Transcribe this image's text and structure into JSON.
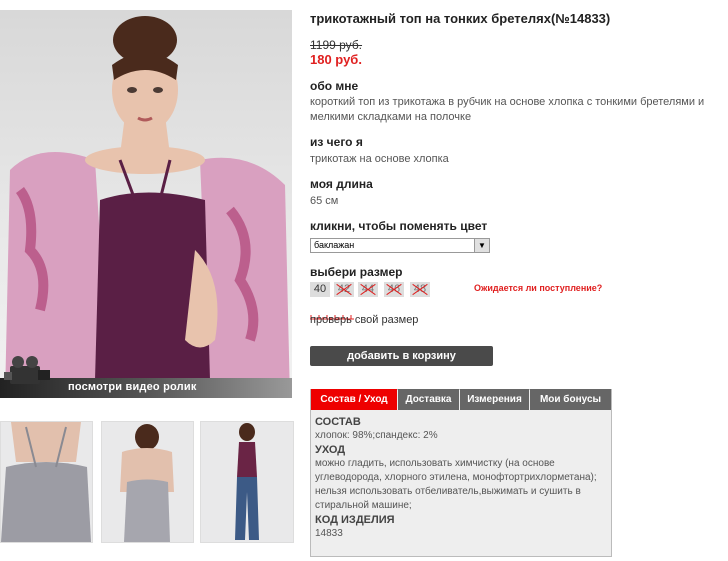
{
  "product": {
    "title": "трикотажный топ на тонких бретелях(№14833)",
    "old_price": "1199 руб.",
    "new_price": "180 руб."
  },
  "sections": {
    "about_heading": "обо мне",
    "about_text": "короткий топ из трикотажа в рубчик на основе хлопка с тонкими бретелями и мелкими складками на полочке",
    "material_heading": "из чего я",
    "material_text": "трикотаж на основе хлопка",
    "length_heading": "моя длина",
    "length_text": "65 см",
    "color_heading": "кликни, чтобы поменять цвет",
    "color_value": "баклажан",
    "size_heading": "выбери размер",
    "notify_link": "Ожидается ли поступление?",
    "size_check": "проверь свой размер",
    "cart_button": "добавить в корзину"
  },
  "sizes": [
    {
      "label": "40",
      "available": true
    },
    {
      "label": "42",
      "available": false
    },
    {
      "label": "44",
      "available": false
    },
    {
      "label": "46",
      "available": false
    },
    {
      "label": "48",
      "available": false
    }
  ],
  "video": {
    "label": "посмотри видео ролик"
  },
  "tabs": [
    "Состав / Уход",
    "Доставка",
    "Измерения",
    "Мои бонусы"
  ],
  "panel": {
    "composition_heading": "СОСТАВ",
    "composition_text": "хлопок: 98%;спандекс: 2%",
    "care_heading": "УХОД",
    "care_text": "можно гладить, использовать химчистку (на основе углеводорода, хлорного этилена, монофтортрихлорметана); нельзя использовать отбеливатель,выжимать и сушить в стиральной машине;",
    "code_heading": "КОД ИЗДЕЛИЯ",
    "code_text": "14833"
  },
  "colors": {
    "accent": "#e00000",
    "price": "#e02020",
    "garment": "#5a1f45"
  }
}
